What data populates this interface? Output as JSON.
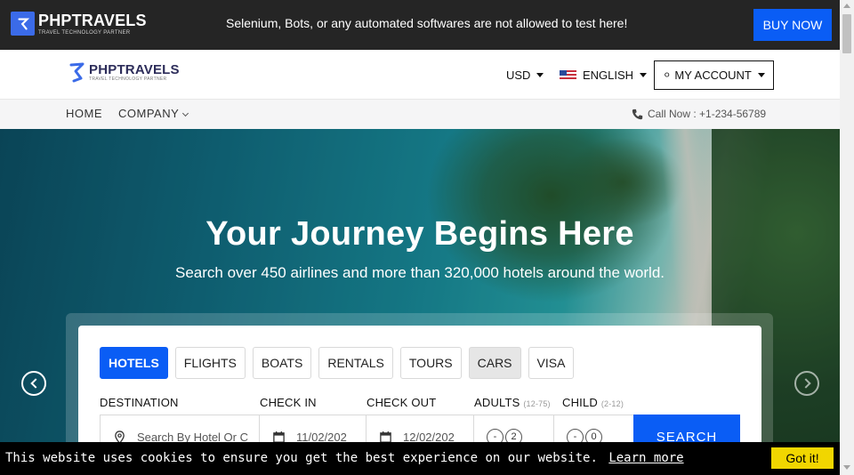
{
  "topbar": {
    "brand": "PHPTRAVELS",
    "tagline": "TRAVEL TECHNOLOGY PARTNER",
    "notice": "Selenium, Bots, or any automated softwares are not allowed to test here!",
    "buy_now": "BUY NOW"
  },
  "header": {
    "brand": "PHPTRAVELS",
    "tagline": "TRAVEL TECHNOLOGY PARTNER",
    "currency": "USD",
    "language": "ENGLISH",
    "account": "MY ACCOUNT"
  },
  "nav": {
    "home": "HOME",
    "company": "COMPANY",
    "call": "Call Now : +1-234-56789"
  },
  "hero": {
    "title": "Your Journey Begins Here",
    "subtitle": "Search over 450 airlines and more than 320,000 hotels around the world."
  },
  "search": {
    "tabs": [
      "HOTELS",
      "FLIGHTS",
      "BOATS",
      "RENTALS",
      "TOURS",
      "CARS",
      "VISA"
    ],
    "active_tab": "HOTELS",
    "labels": {
      "destination": "DESTINATION",
      "checkin": "CHECK IN",
      "checkout": "CHECK OUT",
      "adults": "ADULTS",
      "adults_range": "(12-75)",
      "child": "CHILD",
      "child_range": "(2-12)"
    },
    "destination_placeholder": "Search By Hotel Or C",
    "checkin_value": "11/02/202",
    "checkout_value": "12/02/202",
    "adults_value": "2",
    "child_value": "0",
    "minus": "-",
    "button": "SEARCH"
  },
  "cookie": {
    "message": "This website uses cookies to ensure you get the best experience on our website.",
    "learn_more": "Learn more",
    "got_it": "Got it!"
  },
  "colors": {
    "primary": "#0a5df5",
    "topbar": "#252525",
    "cookie_button": "#f1d600"
  }
}
